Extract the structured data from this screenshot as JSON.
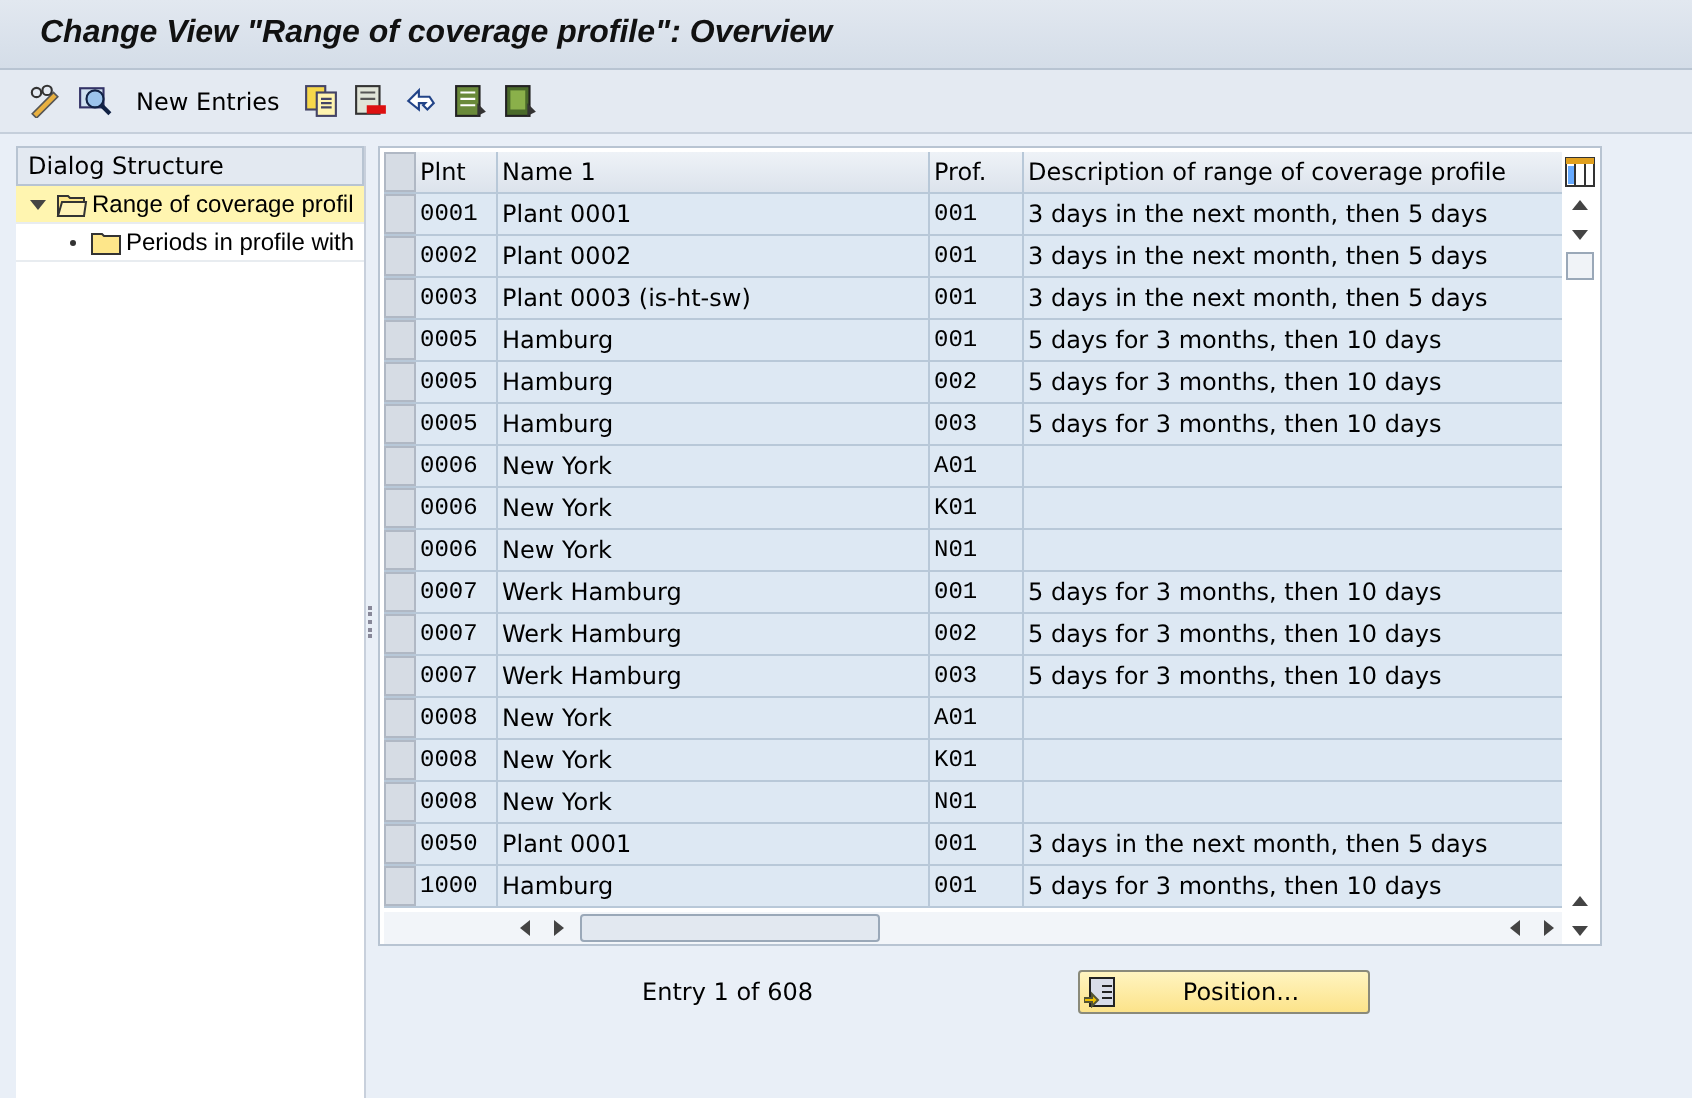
{
  "window": {
    "title": "Change View \"Range of coverage profile\": Overview"
  },
  "toolbar": {
    "new_entries": "New Entries"
  },
  "dialog_structure": {
    "title": "Dialog Structure",
    "items": [
      {
        "label": "Range of coverage profil",
        "expanded": true,
        "selected": true,
        "children": [
          {
            "label": "Periods in profile with",
            "selected": false
          }
        ]
      }
    ]
  },
  "table": {
    "columns": [
      "Plnt",
      "Name 1",
      "Prof.",
      "Description of range of coverage profile"
    ],
    "rows": [
      [
        "0001",
        "Plant 0001",
        "001",
        "3 days in the next month, then 5 days"
      ],
      [
        "0002",
        "Plant 0002",
        "001",
        "3 days in the next month, then 5 days"
      ],
      [
        "0003",
        "Plant 0003 (is-ht-sw)",
        "001",
        "3 days in the next month, then 5 days"
      ],
      [
        "0005",
        "Hamburg",
        "001",
        "5 days for 3 months, then 10 days"
      ],
      [
        "0005",
        "Hamburg",
        "002",
        "5 days for 3 months, then 10 days"
      ],
      [
        "0005",
        "Hamburg",
        "003",
        "5 days for 3 months, then 10 days"
      ],
      [
        "0006",
        "New York",
        "A01",
        ""
      ],
      [
        "0006",
        "New York",
        "K01",
        ""
      ],
      [
        "0006",
        "New York",
        "N01",
        ""
      ],
      [
        "0007",
        "Werk Hamburg",
        "001",
        "5 days for 3 months, then 10 days"
      ],
      [
        "0007",
        "Werk Hamburg",
        "002",
        "5 days for 3 months, then 10 days"
      ],
      [
        "0007",
        "Werk Hamburg",
        "003",
        "5 days for 3 months, then 10 days"
      ],
      [
        "0008",
        "New York",
        "A01",
        ""
      ],
      [
        "0008",
        "New York",
        "K01",
        ""
      ],
      [
        "0008",
        "New York",
        "N01",
        ""
      ],
      [
        "0050",
        "Plant 0001",
        "001",
        "3 days in the next month, then 5 days"
      ],
      [
        "1000",
        "Hamburg",
        "001",
        "5 days for 3 months, then 10 days"
      ]
    ]
  },
  "footer": {
    "entry_info": "Entry 1 of 608",
    "position_button": "Position..."
  }
}
